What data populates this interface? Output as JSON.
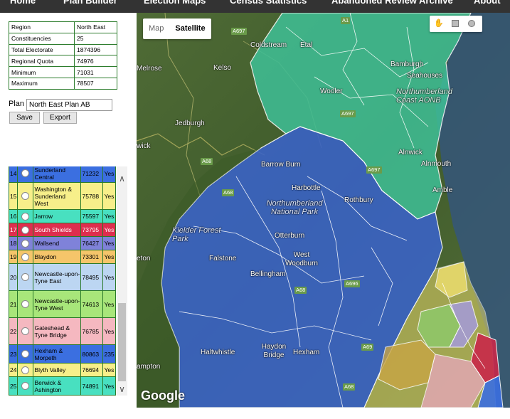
{
  "nav": {
    "items": [
      "Home",
      "Plan Builder",
      "Election Maps",
      "Census Statistics",
      "Abandoned Review Archive",
      "About"
    ]
  },
  "region_summary": {
    "rows": [
      {
        "label": "Region",
        "value": "North East"
      },
      {
        "label": "Constituencies",
        "value": "25"
      },
      {
        "label": "Total Electorate",
        "value": "1874396"
      },
      {
        "label": "Regional Quota",
        "value": "74976"
      },
      {
        "label": "Minimum",
        "value": "71031"
      },
      {
        "label": "Maximum",
        "value": "78507"
      }
    ]
  },
  "plan": {
    "label": "Plan",
    "name_value": "North East Plan AB",
    "save_label": "Save",
    "export_label": "Export"
  },
  "districts": [
    {
      "num": "14",
      "name": "Sunderland Central",
      "electorate": "71232",
      "valid": "Yes",
      "color": "#3b6fe0"
    },
    {
      "num": "15",
      "name": "Washington & Sunderland West",
      "electorate": "75788",
      "valid": "Yes",
      "color": "#f7ef8a"
    },
    {
      "num": "16",
      "name": "Jarrow",
      "electorate": "75597",
      "valid": "Yes",
      "color": "#48e0c0"
    },
    {
      "num": "17",
      "name": "South Shields",
      "electorate": "73795",
      "valid": "Yes",
      "color": "#de2e4e"
    },
    {
      "num": "18",
      "name": "Wallsend",
      "electorate": "76427",
      "valid": "Yes",
      "color": "#7f82d9"
    },
    {
      "num": "19",
      "name": "Blaydon",
      "electorate": "73301",
      "valid": "Yes",
      "color": "#f5c56a"
    },
    {
      "num": "20",
      "name": "Newcastle-upon-Tyne East",
      "electorate": "78495",
      "valid": "Yes",
      "color": "#bcd6f2"
    },
    {
      "num": "21",
      "name": "Newcastle-upon-Tyne West",
      "electorate": "74613",
      "valid": "Yes",
      "color": "#a8e67a"
    },
    {
      "num": "22",
      "name": "Gateshead & Tyne Bridge",
      "electorate": "76785",
      "valid": "Yes",
      "color": "#f5b8c0"
    },
    {
      "num": "23",
      "name": "Hexham & Morpeth",
      "electorate": "80863",
      "valid": "235",
      "color": "#3b6fe0"
    },
    {
      "num": "24",
      "name": "Blyth Valley",
      "electorate": "76694",
      "valid": "Yes",
      "color": "#f7ef8a"
    },
    {
      "num": "25",
      "name": "Berwick & Ashington",
      "electorate": "74891",
      "valid": "Yes",
      "color": "#48e0c0"
    }
  ],
  "map": {
    "type_map_label": "Map",
    "type_satellite_label": "Satellite",
    "attribution": "Google",
    "labels": {
      "coldstream": "Coldstream",
      "etal": "Etal",
      "melrose": "Melrose",
      "kelso": "Kelso",
      "bamburgh": "Bamburgh",
      "seahouses": "Seahouses",
      "wooler": "Wooler",
      "nland_coast": "Northumberland Coast AONB",
      "jedburgh": "Jedburgh",
      "wick": "wick",
      "alnwick": "Alnwick",
      "alnmouth": "Alnmouth",
      "amble": "Amble",
      "barrow_burn": "Barrow Burn",
      "harbottle": "Harbottle",
      "rothbury": "Rothbury",
      "nnp": "Northumberland National Park",
      "kielder": "Kielder Forest Park",
      "otterburn": "Otterburn",
      "falstone": "Falstone",
      "west_woodburn": "West Woodburn",
      "bellingham": "Bellingham",
      "haltwhistle": "Haltwhistle",
      "haydon_bridge": "Haydon Bridge",
      "hexham": "Hexham",
      "ampton": "ampton",
      "eton": "eton",
      "nd": "nd"
    },
    "roads": [
      "A697",
      "A1",
      "A697",
      "A68",
      "A68",
      "A697",
      "A68",
      "A696",
      "A69",
      "A68"
    ]
  },
  "colors": {
    "north_district": "#3fbf96",
    "hexham_district": "#3a63c9",
    "border": "#ffffff"
  }
}
